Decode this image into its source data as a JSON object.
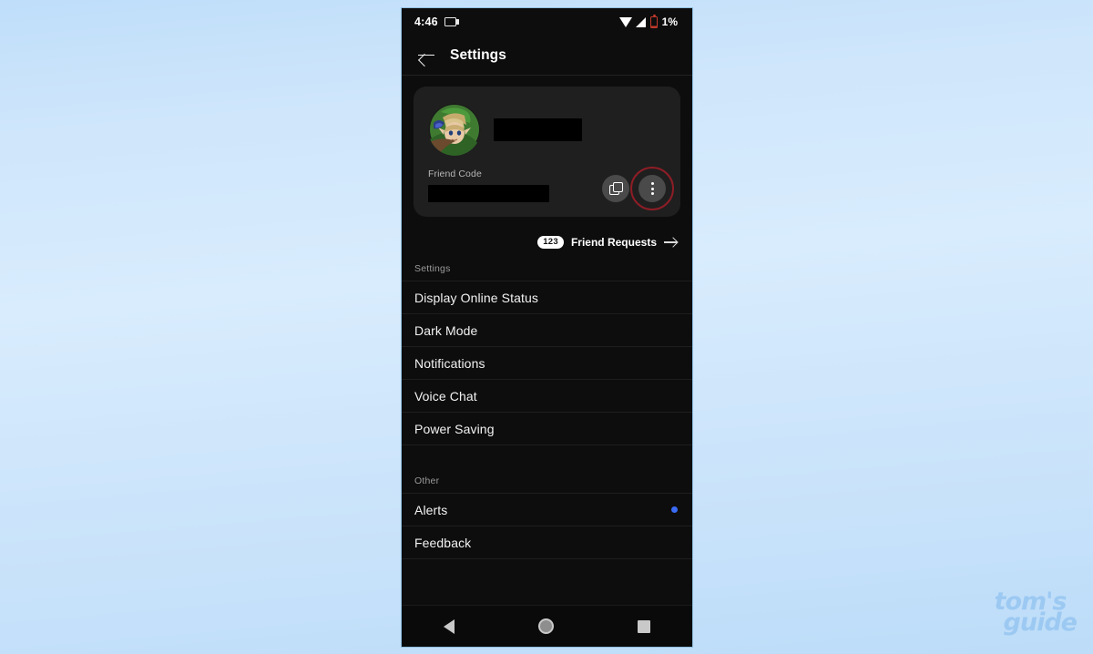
{
  "status_bar": {
    "time": "4:46",
    "cast_icon": "cast-icon",
    "wifi_icon": "wifi-icon",
    "signal_icon": "signal-icon",
    "battery_icon": "battery-icon",
    "battery_percent": "1%",
    "battery_color": "#c0392b"
  },
  "app_bar": {
    "back_icon": "back-arrow-icon",
    "title": "Settings"
  },
  "profile_card": {
    "avatar_alt": "link-zelda-avatar",
    "username_value": "",
    "username_redacted": true,
    "friend_code_label": "Friend Code",
    "friend_code_value": "",
    "friend_code_redacted": true,
    "copy_button_icon": "copy-icon",
    "menu_button_icon": "three-dots-vertical-icon",
    "highlight_ring_color": "#8d1d26",
    "card_bg": "#1f1f1f"
  },
  "friend_requests": {
    "badge_count": "123",
    "label": "Friend Requests",
    "arrow_icon": "arrow-right-icon"
  },
  "sections": [
    {
      "header": "Settings",
      "items": [
        {
          "label": "Display Online Status",
          "dot": false
        },
        {
          "label": "Dark Mode",
          "dot": false
        },
        {
          "label": "Notifications",
          "dot": false
        },
        {
          "label": "Voice Chat",
          "dot": false
        },
        {
          "label": "Power Saving",
          "dot": false
        }
      ]
    },
    {
      "header": "Other",
      "items": [
        {
          "label": "Alerts",
          "dot": true,
          "dot_color": "#3b6bf5"
        },
        {
          "label": "Feedback",
          "dot": false
        }
      ]
    }
  ],
  "nav_bar": {
    "back_icon": "nav-back-triangle-icon",
    "home_icon": "nav-home-circle-icon",
    "recents_icon": "nav-recents-square-icon"
  },
  "watermark": {
    "line1": "tom's",
    "line2": "guide",
    "color": "#9cc9f2"
  },
  "background": {
    "color_top": "#bfdefa",
    "color_mid": "#d8ecfd",
    "color_bottom": "#bcdcf8"
  }
}
